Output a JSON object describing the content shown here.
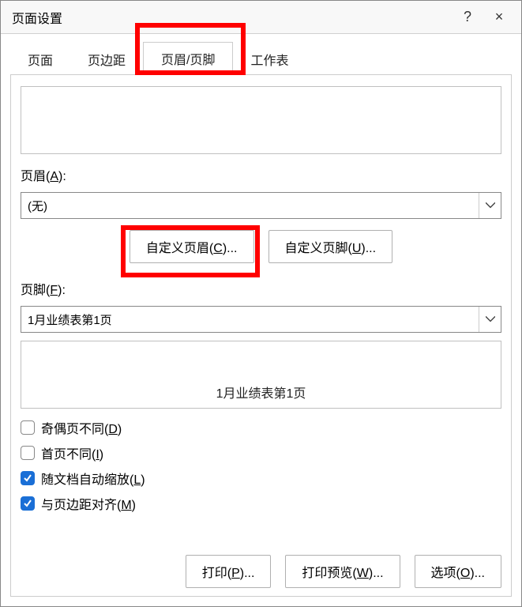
{
  "titlebar": {
    "title": "页面设置",
    "help": "?",
    "close": "×"
  },
  "tabs": {
    "page": "页面",
    "margins": "页边距",
    "headerfooter": "页眉/页脚",
    "sheet": "工作表"
  },
  "labels": {
    "header": "页眉(",
    "header_key": "A",
    "header_suffix": "):",
    "footer": "页脚(",
    "footer_key": "F",
    "footer_suffix": "):"
  },
  "header_select": {
    "value": "(无)"
  },
  "footer_select": {
    "value": "1月业绩表第1页"
  },
  "footer_preview": "1月业绩表第1页",
  "buttons": {
    "custom_header_pre": "自定义页眉(",
    "custom_header_key": "C",
    "custom_header_post": ")...",
    "custom_footer_pre": "自定义页脚(",
    "custom_footer_key": "U",
    "custom_footer_post": ")...",
    "print_pre": "打印(",
    "print_key": "P",
    "print_post": ")...",
    "preview_pre": "打印预览(",
    "preview_key": "W",
    "preview_post": ")...",
    "options_pre": "选项(",
    "options_key": "O",
    "options_post": ")..."
  },
  "checks": {
    "oddeven_pre": "奇偶页不同(",
    "oddeven_key": "D",
    "oddeven_post": ")",
    "firstpage_pre": "首页不同(",
    "firstpage_key": "I",
    "firstpage_post": ")",
    "scale_pre": "随文档自动缩放(",
    "scale_key": "L",
    "scale_post": ")",
    "align_pre": "与页边距对齐(",
    "align_key": "M",
    "align_post": ")"
  }
}
